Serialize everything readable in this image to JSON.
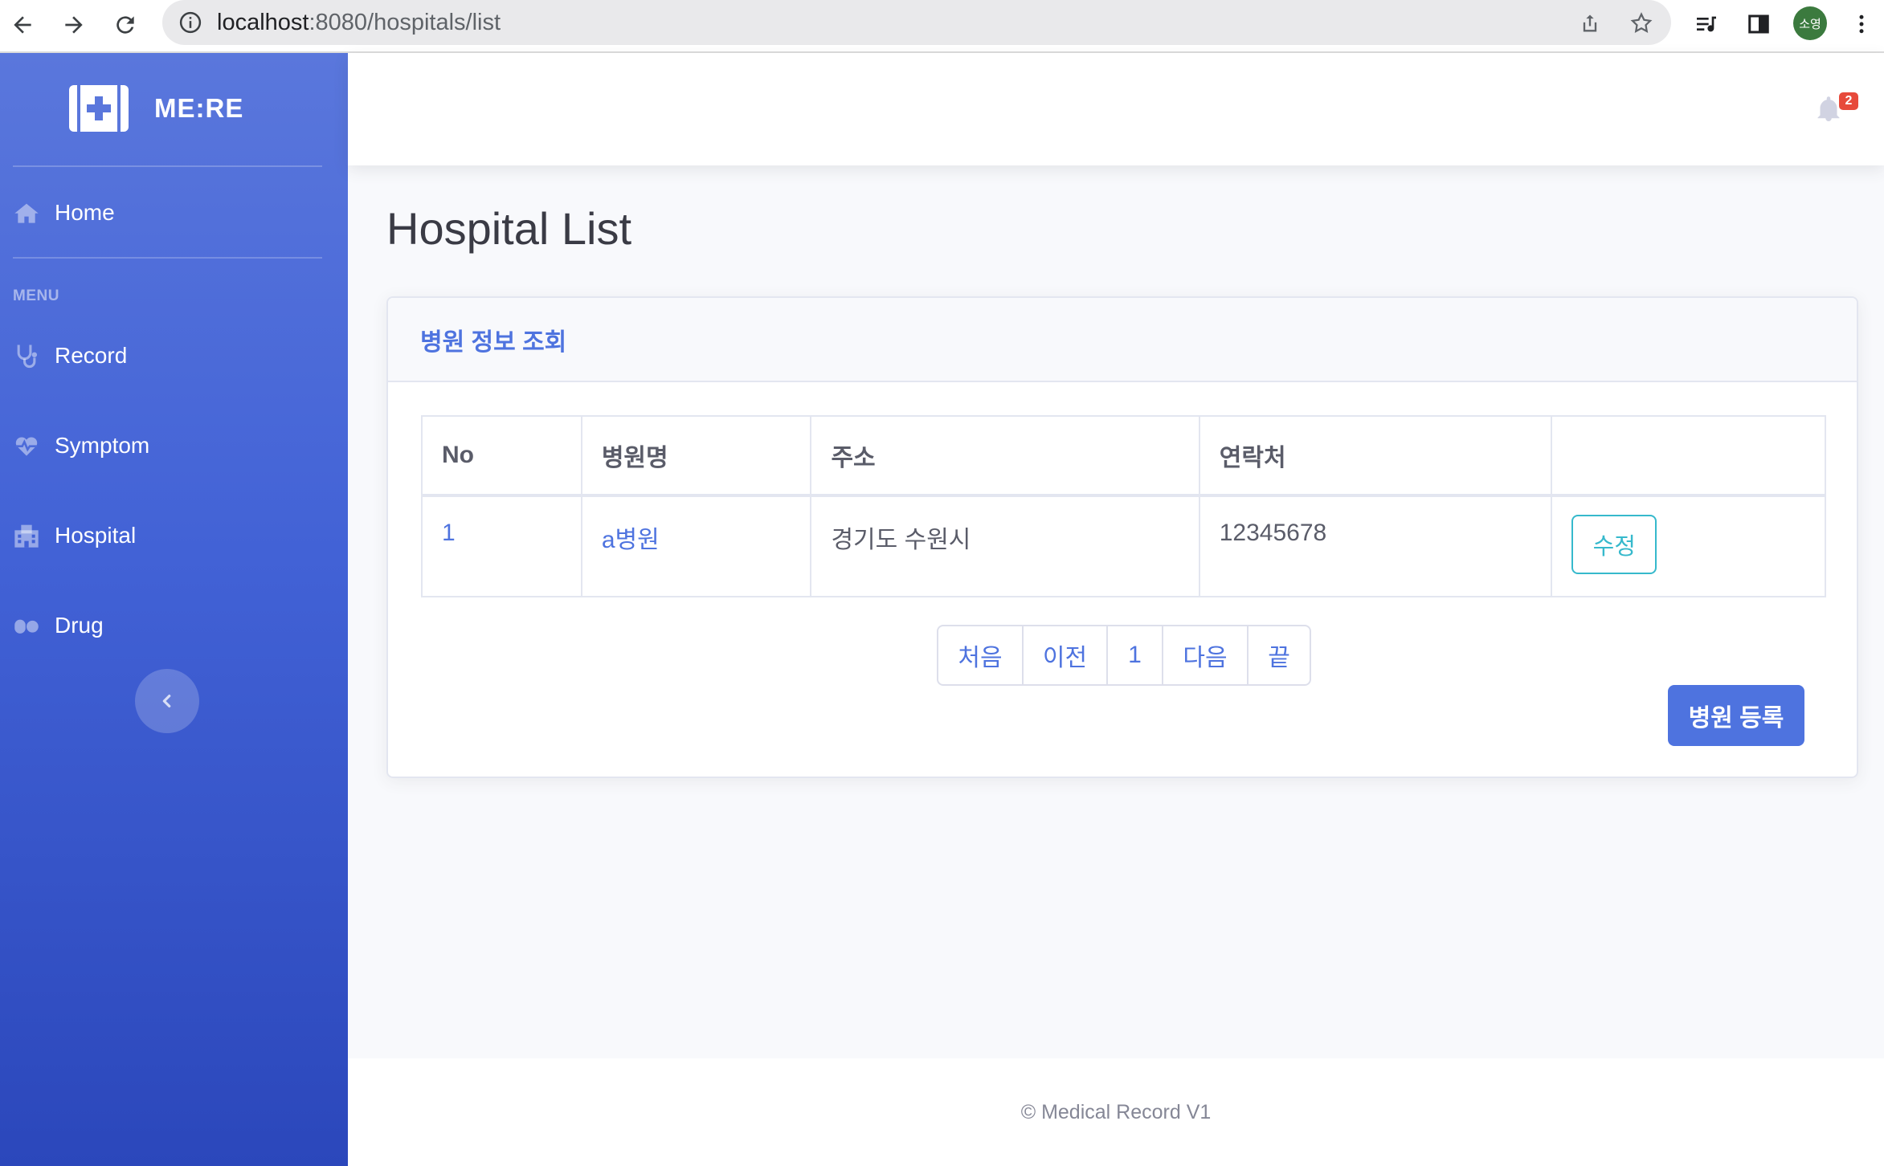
{
  "browser": {
    "url_host": "localhost",
    "url_path": ":8080/hospitals/list",
    "profile_label": "소영"
  },
  "sidebar": {
    "brand": "ME:RE",
    "home_label": "Home",
    "menu_heading": "MENU",
    "items": [
      {
        "label": "Record",
        "icon": "stethoscope-icon"
      },
      {
        "label": "Symptom",
        "icon": "heartbeat-icon"
      },
      {
        "label": "Hospital",
        "icon": "hospital-icon"
      },
      {
        "label": "Drug",
        "icon": "pills-icon"
      }
    ]
  },
  "topbar": {
    "notification_count": "2"
  },
  "page": {
    "title": "Hospital List"
  },
  "card": {
    "title": "병원 정보 조회",
    "columns": [
      "No",
      "병원명",
      "주소",
      "연락처",
      ""
    ],
    "rows": [
      {
        "no": "1",
        "name": "a병원",
        "address": "경기도 수원시",
        "phone": "12345678",
        "action": "수정"
      }
    ],
    "pagination": [
      "처음",
      "이전",
      "1",
      "다음",
      "끝"
    ],
    "register_label": "병원 등록"
  },
  "footer": {
    "text": "© Medical Record V1"
  },
  "colors": {
    "primary": "#4e73df",
    "info": "#36b9cc",
    "danger": "#e74a3b"
  }
}
